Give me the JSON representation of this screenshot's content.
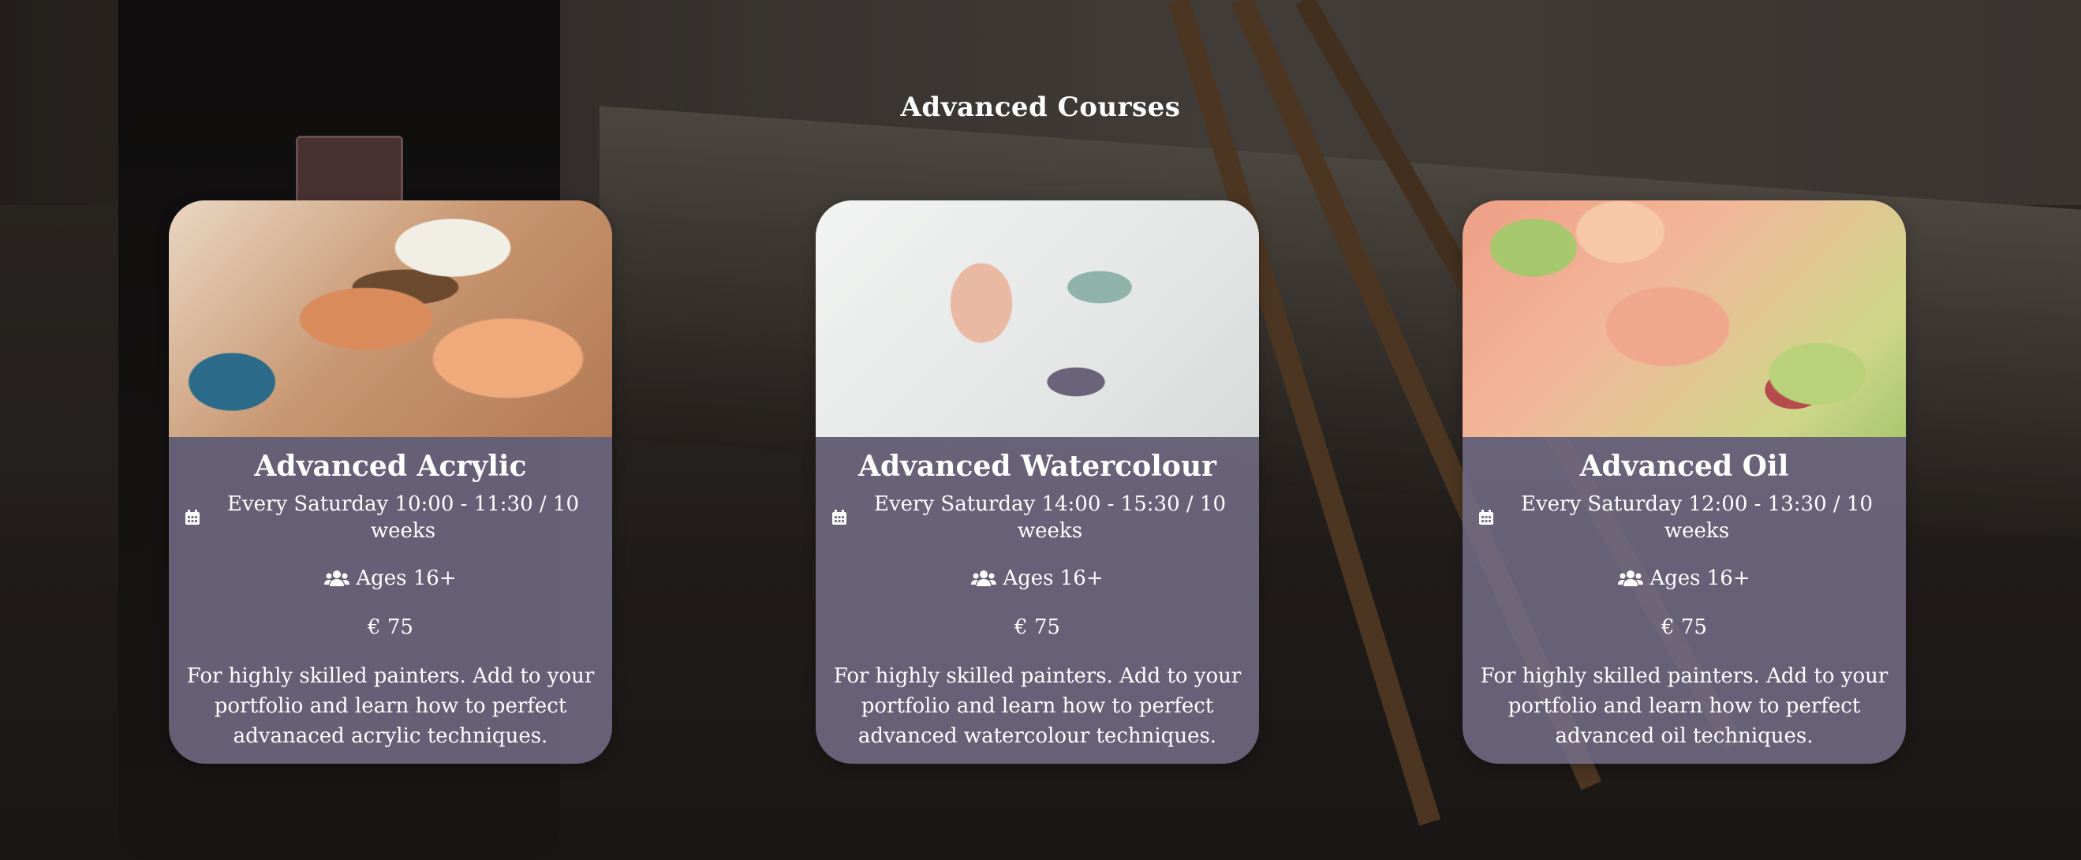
{
  "section": {
    "title": "Advanced Courses"
  },
  "courses": [
    {
      "title": "Advanced Acrylic",
      "schedule": "Every Saturday 10:00 - 11:30 / 10 weeks",
      "ages": "Ages 16+",
      "price": "€ 75",
      "description": "For highly skilled painters. Add to your portfolio and learn how to perfect advanaced acrylic techniques."
    },
    {
      "title": "Advanced Watercolour",
      "schedule": "Every Saturday 14:00 - 15:30 / 10 weeks",
      "ages": "Ages 16+",
      "price": "€ 75",
      "description": "For highly skilled painters. Add to your portfolio and learn how to perfect advanced watercolour techniques."
    },
    {
      "title": "Advanced Oil",
      "schedule": "Every Saturday 12:00 - 13:30 / 10 weeks",
      "ages": "Ages 16+",
      "price": "€ 75",
      "description": "For highly skilled painters. Add to your portfolio and learn how to perfect advanced oil techniques."
    }
  ],
  "icons": {
    "schedule": "calendar-icon",
    "ages": "users-icon"
  },
  "colors": {
    "card_bg": "#787290",
    "text": "#ffffff"
  }
}
